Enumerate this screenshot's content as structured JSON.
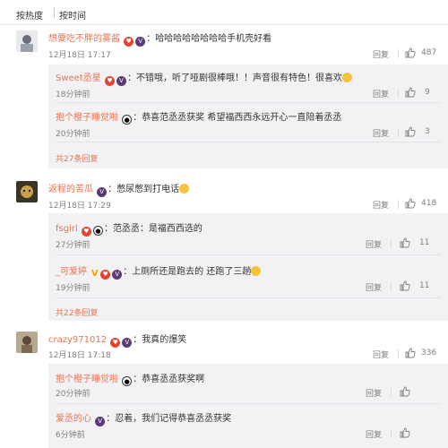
{
  "sort": {
    "hot": "按热度",
    "time": "按时间"
  },
  "reply_label": "回复",
  "comments": [
    {
      "user": "想要吃不胖的雾酱",
      "text": "哈哈哈哈哈哈哈哈手机壳好看",
      "time": "12月18日 17:17",
      "likes": "487",
      "replies": [
        {
          "user": "Sweet丞星",
          "text": "不错哦，听了哑剧很棒哦！！声音很有特色！很喜欢",
          "time": "18分钟前",
          "likes": "9"
        },
        {
          "user": "抱个橙子睡觉啦",
          "text": "恭喜范丞丞获奖   希望福西西永远开心一直陪着丞丞",
          "time": "20分钟前",
          "likes": "3"
        }
      ],
      "more": "共27条回复"
    },
    {
      "user": "返程的苦瓜",
      "text": "憋尿憋到打电话",
      "time": "12月18日 17:29",
      "likes": "418",
      "replies": [
        {
          "user": "fsgirl",
          "text": "范丞丞：是福西西选的",
          "time": "27分钟前",
          "likes": "11"
        },
        {
          "user": "_可爱婷",
          "text": "上厕所还是跑去的 还跑了三趟",
          "time": "19分钟前",
          "likes": "11"
        }
      ],
      "more": "共22条回复"
    },
    {
      "user": "crazy971012",
      "text": "我真的爆笑",
      "time": "12月18日 17:18",
      "likes": "336",
      "replies": [
        {
          "user": "抱个橙子睡觉啦",
          "text": "恭喜丞丞获奖啊",
          "time": "20分钟前",
          "likes": ""
        },
        {
          "user": "爱丞的心",
          "text": "忍着，我们记得恭喜丞丞获奖",
          "time": "6分钟前",
          "likes": ""
        }
      ]
    }
  ]
}
